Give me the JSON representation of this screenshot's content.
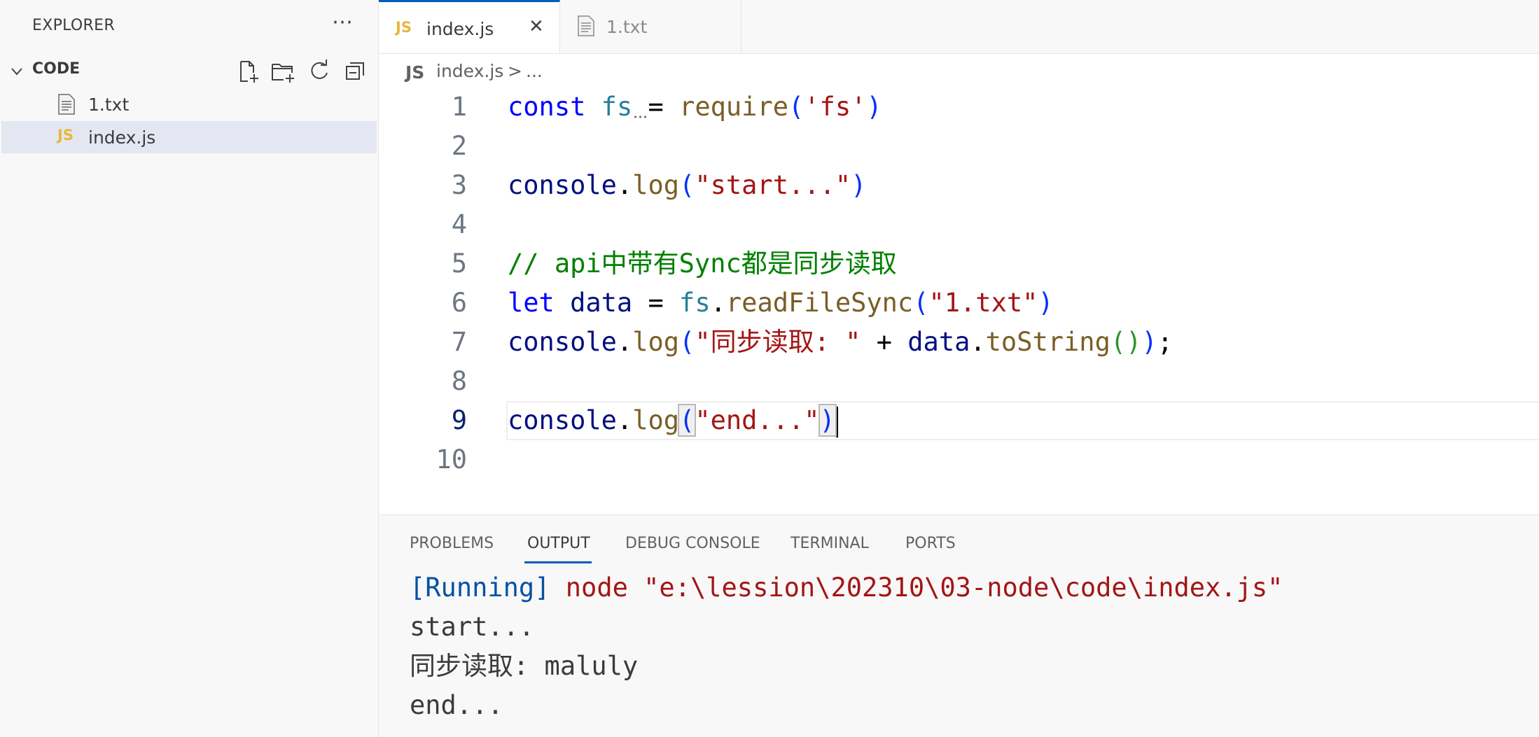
{
  "sidebar": {
    "title": "EXPLORER",
    "more_label": "⋯",
    "folder": "CODE",
    "actions": [
      "new-file-icon",
      "new-folder-icon",
      "refresh-icon",
      "collapse-all-icon"
    ],
    "files": [
      {
        "name": "1.txt",
        "icon": "text-file-icon"
      },
      {
        "name": "index.js",
        "icon": "js-file-icon",
        "badge": "JS",
        "active": true
      }
    ]
  },
  "tabs": [
    {
      "label": "index.js",
      "badge": "JS",
      "active": true,
      "close": "✕"
    },
    {
      "label": "1.txt",
      "active": false
    }
  ],
  "breadcrumb": {
    "badge": "JS",
    "file": "index.js",
    "separator": ">",
    "rest": "..."
  },
  "editor": {
    "line_numbers": [
      "1",
      "2",
      "3",
      "4",
      "5",
      "6",
      "7",
      "8",
      "9",
      "10"
    ],
    "lines": [
      [
        {
          "t": "const",
          "c": "kw"
        },
        {
          "t": " ",
          "c": "op"
        },
        {
          "t": "fs",
          "c": "mod"
        },
        {
          "t": " = ",
          "c": "op"
        },
        {
          "t": "require",
          "c": "fn"
        },
        {
          "t": "(",
          "c": "pn"
        },
        {
          "t": "'fs'",
          "c": "str"
        },
        {
          "t": ")",
          "c": "pn"
        }
      ],
      [],
      [
        {
          "t": "console",
          "c": "var"
        },
        {
          "t": ".",
          "c": "op"
        },
        {
          "t": "log",
          "c": "fn"
        },
        {
          "t": "(",
          "c": "pn"
        },
        {
          "t": "\"start...\"",
          "c": "str"
        },
        {
          "t": ")",
          "c": "pn"
        }
      ],
      [],
      [
        {
          "t": "// api中带有Sync都是同步读取",
          "c": "cm"
        }
      ],
      [
        {
          "t": "let",
          "c": "kw"
        },
        {
          "t": " ",
          "c": "op"
        },
        {
          "t": "data",
          "c": "var"
        },
        {
          "t": " = ",
          "c": "op"
        },
        {
          "t": "fs",
          "c": "mod"
        },
        {
          "t": ".",
          "c": "op"
        },
        {
          "t": "readFileSync",
          "c": "fn"
        },
        {
          "t": "(",
          "c": "pn"
        },
        {
          "t": "\"1.txt\"",
          "c": "str"
        },
        {
          "t": ")",
          "c": "pn"
        }
      ],
      [
        {
          "t": "console",
          "c": "var"
        },
        {
          "t": ".",
          "c": "op"
        },
        {
          "t": "log",
          "c": "fn"
        },
        {
          "t": "(",
          "c": "pn"
        },
        {
          "t": "\"同步读取: \"",
          "c": "str"
        },
        {
          "t": " + ",
          "c": "op"
        },
        {
          "t": "data",
          "c": "var"
        },
        {
          "t": ".",
          "c": "op"
        },
        {
          "t": "toString",
          "c": "fn"
        },
        {
          "t": "()",
          "c": "pn2"
        },
        {
          "t": ")",
          "c": "pn"
        },
        {
          "t": ";",
          "c": "op"
        }
      ],
      [],
      [
        {
          "t": "console",
          "c": "var"
        },
        {
          "t": ".",
          "c": "op"
        },
        {
          "t": "log",
          "c": "fn"
        },
        {
          "t": "(",
          "c": "pn bm"
        },
        {
          "t": "\"end...\"",
          "c": "str"
        },
        {
          "t": ")",
          "c": "pn bm"
        }
      ],
      []
    ],
    "current_line": 9
  },
  "panel": {
    "tabs": [
      "PROBLEMS",
      "OUTPUT",
      "DEBUG CONSOLE",
      "TERMINAL",
      "PORTS"
    ],
    "active_tab": "OUTPUT",
    "output": {
      "running_tag": "[Running]",
      "command": "node \"e:\\lession\\202310\\03-node\\code\\index.js\"",
      "lines": [
        "start...",
        "同步读取: maluly",
        "end..."
      ]
    }
  }
}
